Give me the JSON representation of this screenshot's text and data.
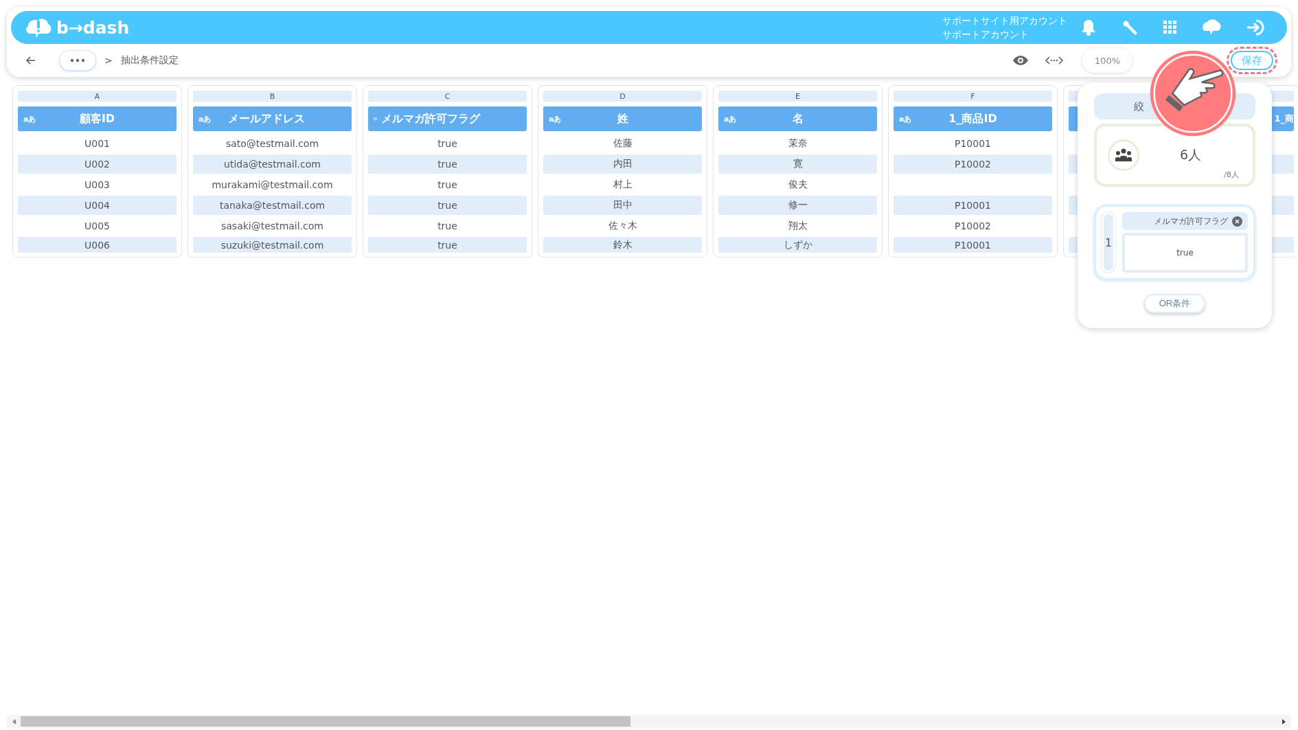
{
  "header": {
    "logo": "b→dash",
    "account_site": "サポートサイト用アカウント",
    "account_name": "サポートアカウント"
  },
  "breadcrumb": {
    "separator": ">",
    "current": "抽出条件設定"
  },
  "toolbar": {
    "zoom": "100%",
    "save": "保存",
    "save_highlighted": true
  },
  "columns": [
    {
      "letter": "A",
      "kind": "text",
      "type_label": "aあ",
      "name": "顧客ID",
      "cells": [
        "U001",
        "U002",
        "U003",
        "U004",
        "U005",
        "U006"
      ]
    },
    {
      "letter": "B",
      "kind": "text",
      "type_label": "aあ",
      "name": "メールアドレス",
      "cells": [
        "sato@testmail.com",
        "utida@testmail.com",
        "murakami@testmail.com",
        "tanaka@testmail.com",
        "sasaki@testmail.com",
        "suzuki@testmail.com"
      ]
    },
    {
      "letter": "C",
      "kind": "flag",
      "name": "メルマガ許可フラグ",
      "cells": [
        "true",
        "true",
        "true",
        "true",
        "true",
        "true"
      ]
    },
    {
      "letter": "D",
      "kind": "text",
      "type_label": "aあ",
      "name": "姓",
      "cells": [
        "佐藤",
        "内田",
        "村上",
        "田中",
        "佐々木",
        "鈴木"
      ]
    },
    {
      "letter": "E",
      "kind": "text",
      "type_label": "aあ",
      "name": "名",
      "cells": [
        "茉奈",
        "寛",
        "俊夫",
        "修一",
        "翔太",
        "しずか"
      ]
    },
    {
      "letter": "F",
      "kind": "text",
      "type_label": "aあ",
      "name": "1_商品ID",
      "cells": [
        "P10001",
        "P10002",
        null,
        "P10001",
        "P10002",
        "P10001"
      ]
    },
    {
      "kind": "clipped",
      "name": "1_商"
    }
  ],
  "panel": {
    "title": "絞",
    "count": "6人",
    "total": "/8人",
    "conditions": [
      {
        "index": "1",
        "field": "メルマガ許可フラグ",
        "value": "true"
      }
    ],
    "or_button": "OR条件"
  }
}
